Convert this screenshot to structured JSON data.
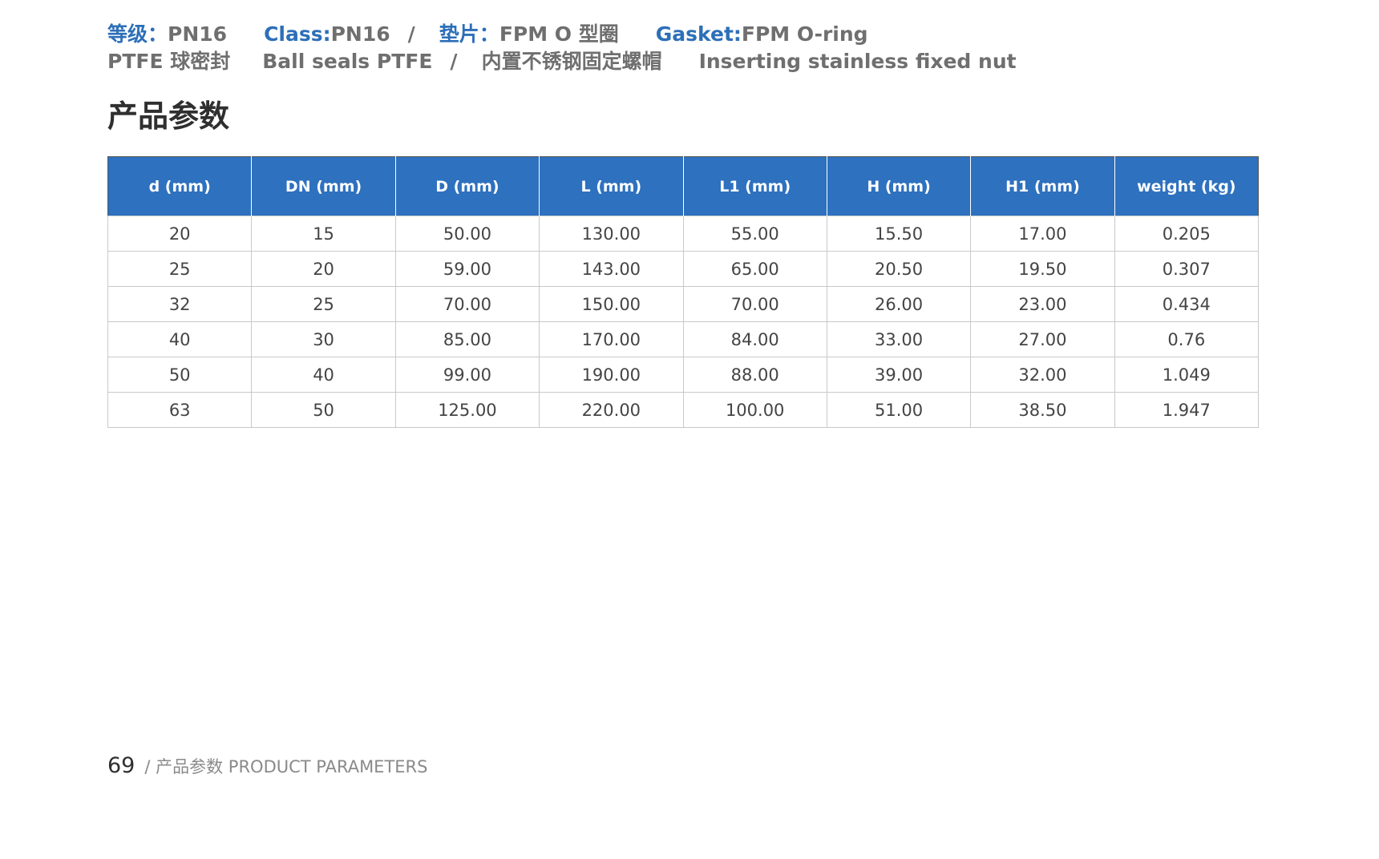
{
  "specs": {
    "grade_label": "等级：",
    "grade_value": "PN16",
    "class_label": "Class:",
    "class_value": " PN16",
    "slash": "/",
    "gasket_cn_label": "垫片：",
    "gasket_cn_value": "FPM O 型圈",
    "gasket_en_label": "Gasket:",
    "gasket_en_value": " FPM O-ring",
    "seal_cn": "PTFE 球密封",
    "seal_en": "Ball seals PTFE",
    "nut_cn": "内置不锈钢固定螺帽",
    "nut_en": "Inserting stainless fixed nut"
  },
  "section_title": "产品参数",
  "table": {
    "headers": [
      "d (mm)",
      "DN (mm)",
      "D (mm)",
      "L (mm)",
      "L1 (mm)",
      "H (mm)",
      "H1 (mm)",
      "weight (kg)"
    ],
    "rows": [
      [
        "20",
        "15",
        "50.00",
        "130.00",
        "55.00",
        "15.50",
        "17.00",
        "0.205"
      ],
      [
        "25",
        "20",
        "59.00",
        "143.00",
        "65.00",
        "20.50",
        "19.50",
        "0.307"
      ],
      [
        "32",
        "25",
        "70.00",
        "150.00",
        "70.00",
        "26.00",
        "23.00",
        "0.434"
      ],
      [
        "40",
        "30",
        "85.00",
        "170.00",
        "84.00",
        "33.00",
        "27.00",
        "0.76"
      ],
      [
        "50",
        "40",
        "99.00",
        "190.00",
        "88.00",
        "39.00",
        "32.00",
        "1.049"
      ],
      [
        "63",
        "50",
        "125.00",
        "220.00",
        "100.00",
        "51.00",
        "38.50",
        "1.947"
      ]
    ]
  },
  "footer": {
    "page_number": "69",
    "text": "/ 产品参数  PRODUCT PARAMETERS"
  },
  "colors": {
    "accent": "#2e71bf",
    "label_blue": "#2d6fb8",
    "muted_text": "#6f6f6f"
  }
}
